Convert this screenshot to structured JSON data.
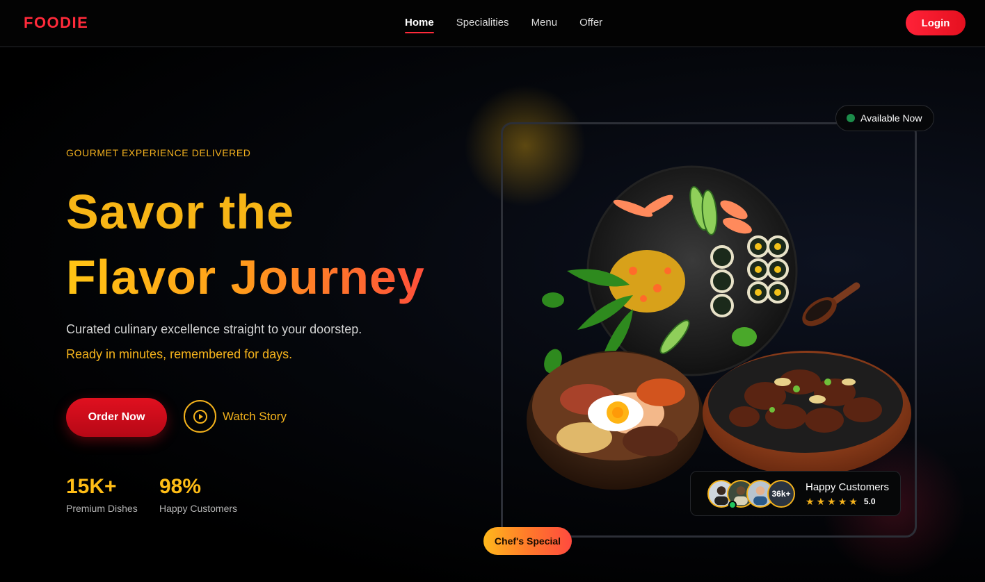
{
  "brand": {
    "logo": "FOODIE"
  },
  "nav": {
    "links": [
      {
        "label": "Home",
        "active": true
      },
      {
        "label": "Specialities",
        "active": false
      },
      {
        "label": "Menu",
        "active": false
      },
      {
        "label": "Offer",
        "active": false
      }
    ],
    "login_label": "Login"
  },
  "hero": {
    "eyebrow": "GOURMET EXPERIENCE DELIVERED",
    "headline_line1": "Savor the",
    "headline_word2": "Flavor",
    "headline_word3": "Journey",
    "subtitle_1": "Curated culinary excellence straight to your doorstep.",
    "subtitle_2": "Ready in minutes, remembered for days.",
    "order_button": "Order Now",
    "watch_label": "Watch Story",
    "stats": [
      {
        "value": "15K+",
        "label": "Premium Dishes"
      },
      {
        "value": "98%",
        "label": "Happy Customers"
      }
    ]
  },
  "showcase": {
    "availability": "Available Now",
    "customers_card": {
      "count_badge": "36k+",
      "title": "Happy Customers",
      "rating": "5.0",
      "stars": 5
    },
    "badge": "Chef's Special"
  },
  "colors": {
    "brand_red": "#ff2a3a",
    "accent_yellow": "#f5b31c",
    "accent_orange": "#ff7a2a"
  },
  "icons": [
    "play-icon",
    "star-icon",
    "status-dot-icon"
  ]
}
